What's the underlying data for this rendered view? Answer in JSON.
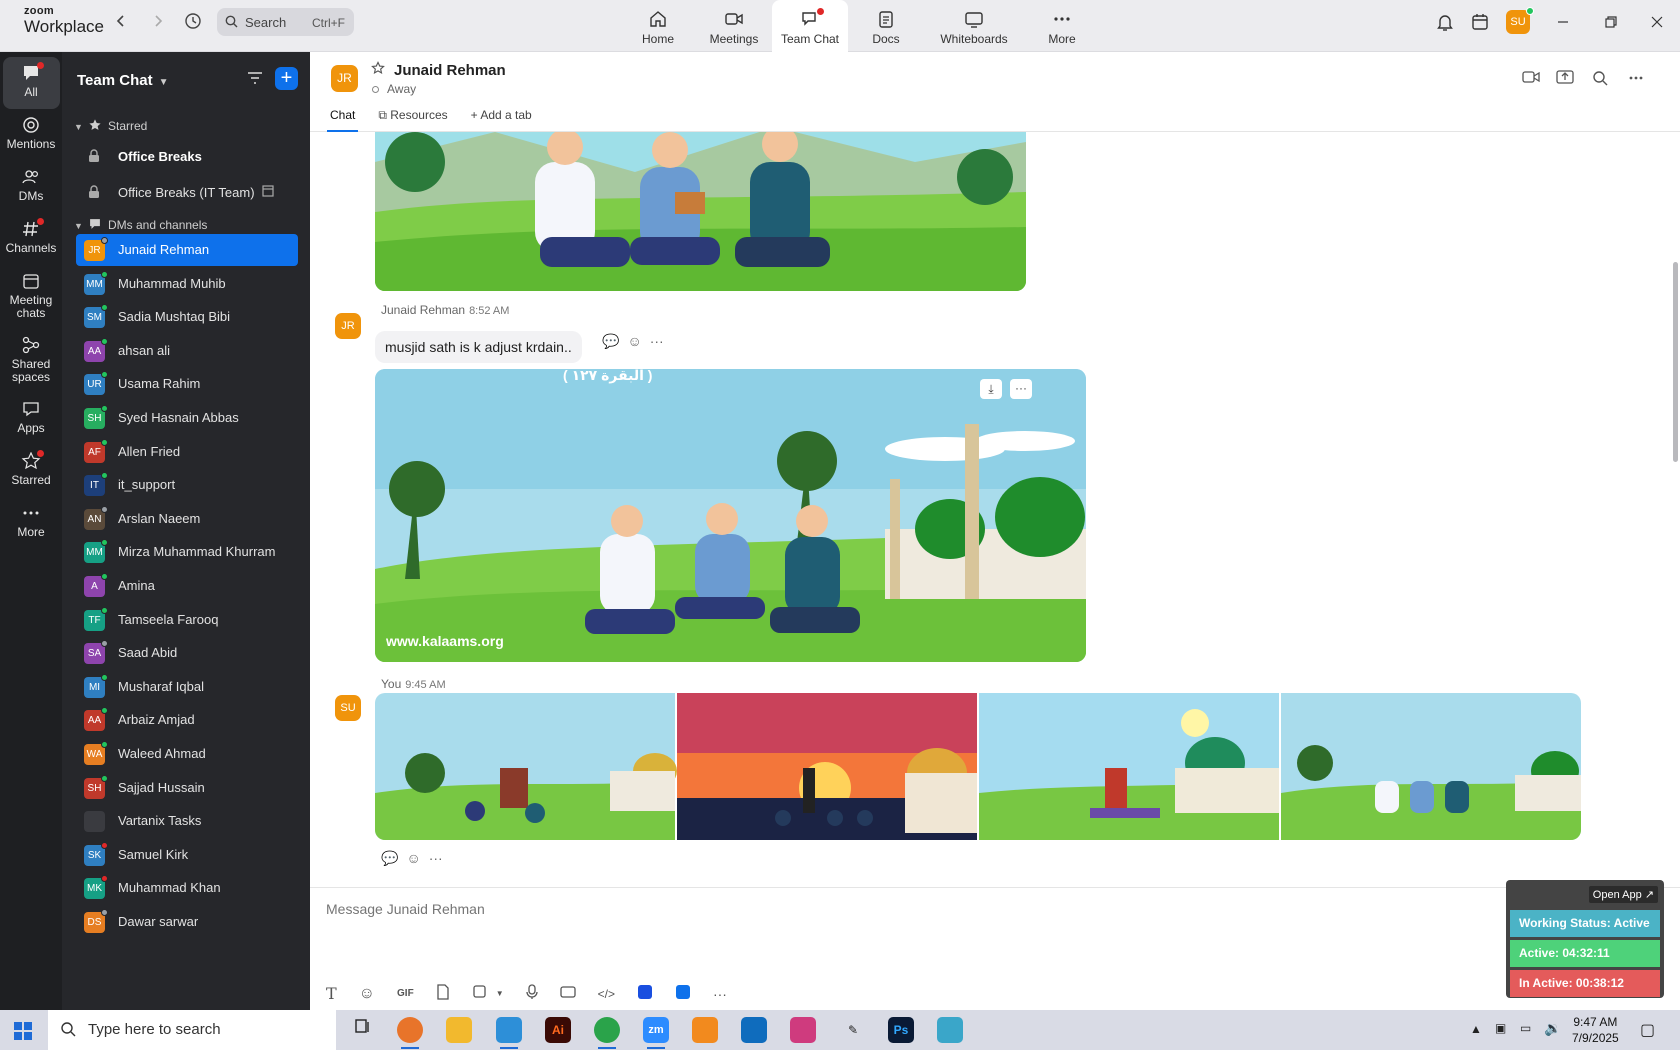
{
  "app": {
    "brand_top": "zoom",
    "brand_bottom": "Workplace"
  },
  "search": {
    "label": "Search",
    "shortcut": "Ctrl+F"
  },
  "top_tabs": [
    {
      "label": "Home",
      "icon": "home-icon"
    },
    {
      "label": "Meetings",
      "icon": "video-icon"
    },
    {
      "label": "Team Chat",
      "icon": "chat-icon"
    },
    {
      "label": "Docs",
      "icon": "doc-icon"
    },
    {
      "label": "Whiteboards",
      "icon": "whiteboard-icon"
    },
    {
      "label": "More",
      "icon": "more-icon"
    }
  ],
  "user": {
    "initials": "SU"
  },
  "rail": [
    {
      "label": "All",
      "icon": "chat-bubble-icon"
    },
    {
      "label": "Mentions",
      "icon": "at-icon"
    },
    {
      "label": "DMs",
      "icon": "people-icon"
    },
    {
      "label": "Channels",
      "icon": "hash-icon"
    },
    {
      "label": "Meeting",
      "label2": "chats",
      "icon": "calendar-icon"
    },
    {
      "label": "Shared",
      "label2": "spaces",
      "icon": "share-icon"
    },
    {
      "label": "Apps",
      "icon": "apps-icon"
    },
    {
      "label": "Starred",
      "icon": "star-icon"
    },
    {
      "label": "More",
      "icon": "more-dots-icon"
    }
  ],
  "panel": {
    "title": "Team Chat",
    "starred_header": "Starred",
    "starred": [
      {
        "name": "Office Breaks"
      },
      {
        "name": "Office Breaks (IT Team)"
      }
    ],
    "dm_header": "DMs and channels",
    "contacts": [
      {
        "name": "Junaid Rehman",
        "initials": "JR",
        "color": "#f0940b",
        "status": "away"
      },
      {
        "name": "Muhammad Muhib",
        "initials": "MM",
        "color": "#2f7fc1",
        "status": "online"
      },
      {
        "name": "Sadia Mushtaq Bibi",
        "initials": "SM",
        "color": "#2f7fc1",
        "status": "online"
      },
      {
        "name": "ahsan ali",
        "initials": "AA",
        "color": "#8e44ad",
        "status": "online"
      },
      {
        "name": "Usama Rahim",
        "initials": "UR",
        "color": "#2f7fc1",
        "status": "online"
      },
      {
        "name": "Syed Hasnain Abbas",
        "initials": "SH",
        "color": "#27ae60",
        "status": "online"
      },
      {
        "name": "Allen Fried",
        "initials": "AF",
        "color": "#c0392b",
        "status": "online"
      },
      {
        "name": "it_support",
        "initials": "IT",
        "color": "#1d3f7a",
        "status": "online"
      },
      {
        "name": "Arslan Naeem",
        "initials": "AN",
        "color": "#5a4a3a",
        "status": "away"
      },
      {
        "name": "Mirza Muhammad Khurram",
        "initials": "MM",
        "color": "#16a085",
        "status": "online"
      },
      {
        "name": "Amina",
        "initials": "A",
        "color": "#8e44ad",
        "status": "online"
      },
      {
        "name": "Tamseela Farooq",
        "initials": "TF",
        "color": "#16a085",
        "status": "online"
      },
      {
        "name": "Saad Abid",
        "initials": "SA",
        "color": "#8e44ad",
        "status": "away"
      },
      {
        "name": "Musharaf Iqbal",
        "initials": "MI",
        "color": "#2f7fc1",
        "status": "online"
      },
      {
        "name": "Arbaiz Amjad",
        "initials": "AA",
        "color": "#c0392b",
        "status": "online"
      },
      {
        "name": "Waleed Ahmad",
        "initials": "WA",
        "color": "#e67e22",
        "status": "online"
      },
      {
        "name": "Sajjad Hussain",
        "initials": "SH",
        "color": "#c0392b",
        "status": "online"
      },
      {
        "name": "Vartanix Tasks",
        "initials": "",
        "color": "#3a3b40",
        "status": "none"
      },
      {
        "name": "Samuel Kirk",
        "initials": "SK",
        "color": "#2f7fc1",
        "status": "busy"
      },
      {
        "name": "Muhammad Khan",
        "initials": "MK",
        "color": "#16a085",
        "status": "busy"
      },
      {
        "name": "Dawar sarwar",
        "initials": "DS",
        "color": "#e67e22",
        "status": "away"
      }
    ]
  },
  "chat": {
    "name": "Junaid Rehman",
    "initials": "JR",
    "presence": "Away",
    "tabs": [
      "Chat",
      "Resources",
      "Add a tab"
    ],
    "messages": [
      {
        "sender": "Junaid Rehman",
        "time": "8:52 AM",
        "text": "musjid sath is k adjust krdain..",
        "image_caption": "www.kalaams.org",
        "image_header": "( البقرة ١٢٧ )"
      },
      {
        "sender": "You",
        "time": "9:45 AM",
        "avatar": "SU"
      }
    ],
    "composer_placeholder": "Message Junaid Rehman",
    "composer_tools": [
      "text-format-icon",
      "emoji-icon",
      "GIF",
      "file-icon",
      "screenshot-icon",
      "mic-icon",
      "video-clip-icon",
      "code-icon",
      "app-icon",
      "app2-icon",
      "more-icon"
    ]
  },
  "widget": {
    "open": "Open App ↗",
    "working": "Working Status: Active",
    "active": "Active: 04:32:11",
    "inactive": "In Active: 00:38:12",
    "colors": {
      "working": "#4bb3c6",
      "active": "#4ed27a",
      "inactive": "#e45b5b"
    }
  },
  "taskbar": {
    "search": "Type here to search",
    "time": "9:47 AM",
    "date": "7/9/2025"
  }
}
